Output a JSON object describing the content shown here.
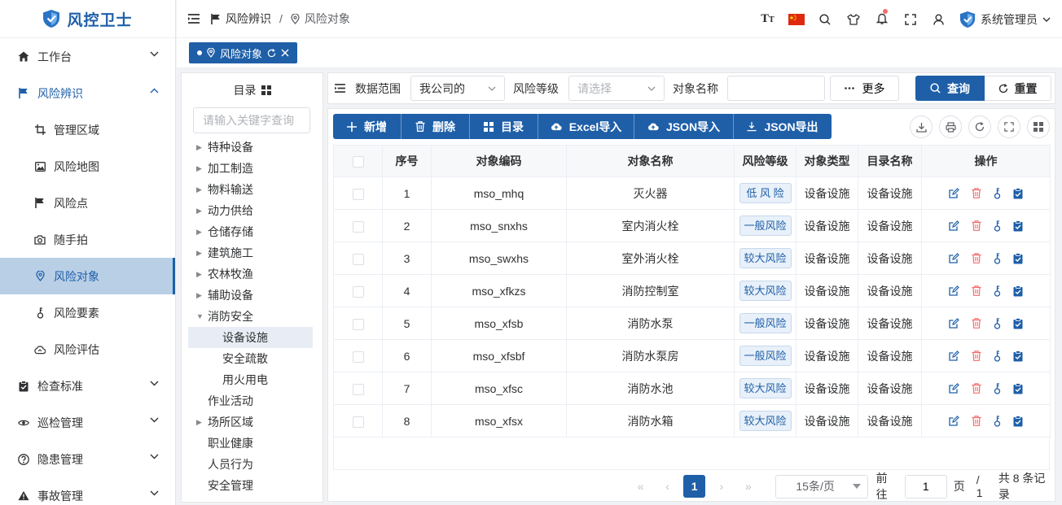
{
  "app": {
    "title": "风控卫士"
  },
  "sidebar": {
    "items": [
      {
        "label": "工作台",
        "icon": "home-icon",
        "level": "top",
        "expandable": true
      },
      {
        "label": "风险辨识",
        "icon": "flag-icon",
        "level": "top",
        "expandable": true,
        "open": true
      },
      {
        "label": "管理区域",
        "icon": "crop-icon",
        "level": "sub"
      },
      {
        "label": "风险地图",
        "icon": "picture-icon",
        "level": "sub"
      },
      {
        "label": "风险点",
        "icon": "flag-icon",
        "level": "sub"
      },
      {
        "label": "随手拍",
        "icon": "camera-icon",
        "level": "sub"
      },
      {
        "label": "风险对象",
        "icon": "location-icon",
        "level": "sub",
        "active": true
      },
      {
        "label": "风险要素",
        "icon": "key-icon",
        "level": "sub"
      },
      {
        "label": "风险评估",
        "icon": "cloud-icon",
        "level": "sub"
      },
      {
        "label": "检查标准",
        "icon": "clipboard-icon",
        "level": "top",
        "expandable": true
      },
      {
        "label": "巡检管理",
        "icon": "eye-icon",
        "level": "top",
        "expandable": true
      },
      {
        "label": "隐患管理",
        "icon": "question-icon",
        "level": "top",
        "expandable": true
      },
      {
        "label": "事故管理",
        "icon": "warning-icon",
        "level": "top",
        "expandable": true
      }
    ]
  },
  "header": {
    "breadcrumb": [
      {
        "label": "风险辨识"
      },
      {
        "label": "风险对象"
      }
    ],
    "breadcrumb_sep": "/",
    "user": "系统管理员"
  },
  "tags": [
    {
      "label": "风险对象"
    }
  ],
  "tree": {
    "title": "目录",
    "search_placeholder": "请输入关键字查询",
    "nodes": [
      {
        "label": "特种设备",
        "arrow": "right"
      },
      {
        "label": "加工制造",
        "arrow": "right"
      },
      {
        "label": "物料输送",
        "arrow": "right"
      },
      {
        "label": "动力供给",
        "arrow": "right"
      },
      {
        "label": "仓储存储",
        "arrow": "right"
      },
      {
        "label": "建筑施工",
        "arrow": "right"
      },
      {
        "label": "农林牧渔",
        "arrow": "right"
      },
      {
        "label": "辅助设备",
        "arrow": "right"
      },
      {
        "label": "消防安全",
        "arrow": "down"
      },
      {
        "label": "设备设施",
        "child": true,
        "selected": true
      },
      {
        "label": "安全疏散",
        "child": true
      },
      {
        "label": "用火用电",
        "child": true
      },
      {
        "label": "作业活动",
        "arrow": "none"
      },
      {
        "label": "场所区域",
        "arrow": "right"
      },
      {
        "label": "职业健康",
        "arrow": "none"
      },
      {
        "label": "人员行为",
        "arrow": "none"
      },
      {
        "label": "安全管理",
        "arrow": "none"
      }
    ]
  },
  "query": {
    "scope_label": "数据范围",
    "scope_value": "我公司的",
    "level_label": "风险等级",
    "level_placeholder": "请选择",
    "name_label": "对象名称",
    "name_value": "",
    "more_label": "更多",
    "query_label": "查询",
    "reset_label": "重置"
  },
  "toolbar": [
    {
      "label": "新增",
      "icon": "plus-icon"
    },
    {
      "label": "删除",
      "icon": "trash-icon"
    },
    {
      "label": "目录",
      "icon": "grid-icon"
    },
    {
      "label": "Excel导入",
      "icon": "cloud-upload-icon"
    },
    {
      "label": "JSON导入",
      "icon": "cloud-upload-icon"
    },
    {
      "label": "JSON导出",
      "icon": "download-icon"
    }
  ],
  "table": {
    "columns": [
      "序号",
      "对象编码",
      "对象名称",
      "风险等级",
      "对象类型",
      "目录名称",
      "操作"
    ],
    "rows": [
      {
        "no": "1",
        "code": "mso_mhq",
        "name": "灭火器",
        "level": "低 风 险",
        "type": "设备设施",
        "dir": "设备设施"
      },
      {
        "no": "2",
        "code": "mso_snxhs",
        "name": "室内消火栓",
        "level": "一般风险",
        "type": "设备设施",
        "dir": "设备设施"
      },
      {
        "no": "3",
        "code": "mso_swxhs",
        "name": "室外消火栓",
        "level": "较大风险",
        "type": "设备设施",
        "dir": "设备设施"
      },
      {
        "no": "4",
        "code": "mso_xfkzs",
        "name": "消防控制室",
        "level": "较大风险",
        "type": "设备设施",
        "dir": "设备设施"
      },
      {
        "no": "5",
        "code": "mso_xfsb",
        "name": "消防水泵",
        "level": "一般风险",
        "type": "设备设施",
        "dir": "设备设施"
      },
      {
        "no": "6",
        "code": "mso_xfsbf",
        "name": "消防水泵房",
        "level": "一般风险",
        "type": "设备设施",
        "dir": "设备设施"
      },
      {
        "no": "7",
        "code": "mso_xfsc",
        "name": "消防水池",
        "level": "较大风险",
        "type": "设备设施",
        "dir": "设备设施"
      },
      {
        "no": "8",
        "code": "mso_xfsx",
        "name": "消防水箱",
        "level": "较大风险",
        "type": "设备设施",
        "dir": "设备设施"
      }
    ]
  },
  "pagination": {
    "current_page": "1",
    "page_size": "15条/页",
    "goto_label": "前往",
    "goto_value": "1",
    "page_unit": "页",
    "total_pages": "/ 1",
    "total": "共 8 条记录"
  },
  "colors": {
    "primary": "#1f5fa8",
    "danger": "#f56c6c",
    "active_bg": "#b8cfe6"
  }
}
